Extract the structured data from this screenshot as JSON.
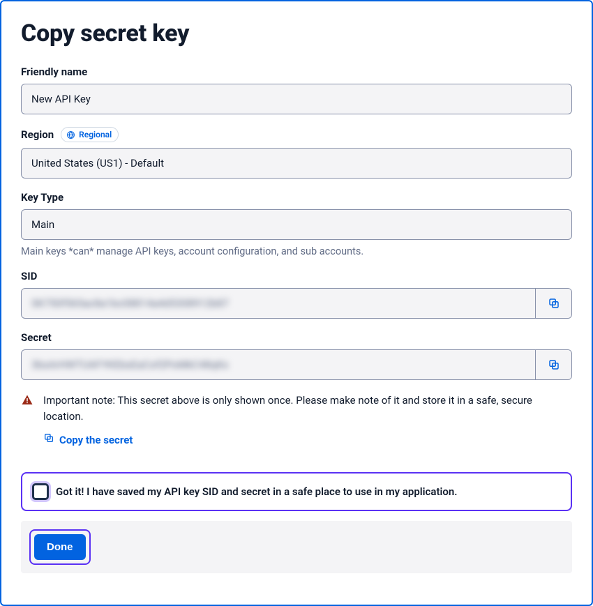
{
  "title": "Copy secret key",
  "friendly_name": {
    "label": "Friendly name",
    "value": "New API Key"
  },
  "region": {
    "label": "Region",
    "badge": "Regional",
    "value": "United States (US1) - Default"
  },
  "key_type": {
    "label": "Key Type",
    "value": "Main",
    "helper": "Main keys *can* manage API keys, account configuration, and sub accounts."
  },
  "sid": {
    "label": "SID",
    "value": "SK750f565ac8a1bc08814a4d5308912b87"
  },
  "secret": {
    "label": "Secret",
    "value": "3bsArHWTUAFYKEbsEaCof2PoMkC48qKx"
  },
  "note": {
    "text": "Important note: This secret above is only shown once. Please make note of it and store it in a safe, secure location.",
    "copy_link": "Copy the secret"
  },
  "ack": {
    "label": "Got it! I have saved my API key SID and secret in a safe place to use in my application."
  },
  "footer": {
    "done": "Done"
  },
  "colors": {
    "accent": "#0263E0",
    "focus": "#5A31F4",
    "warn": "#B02A1A"
  }
}
